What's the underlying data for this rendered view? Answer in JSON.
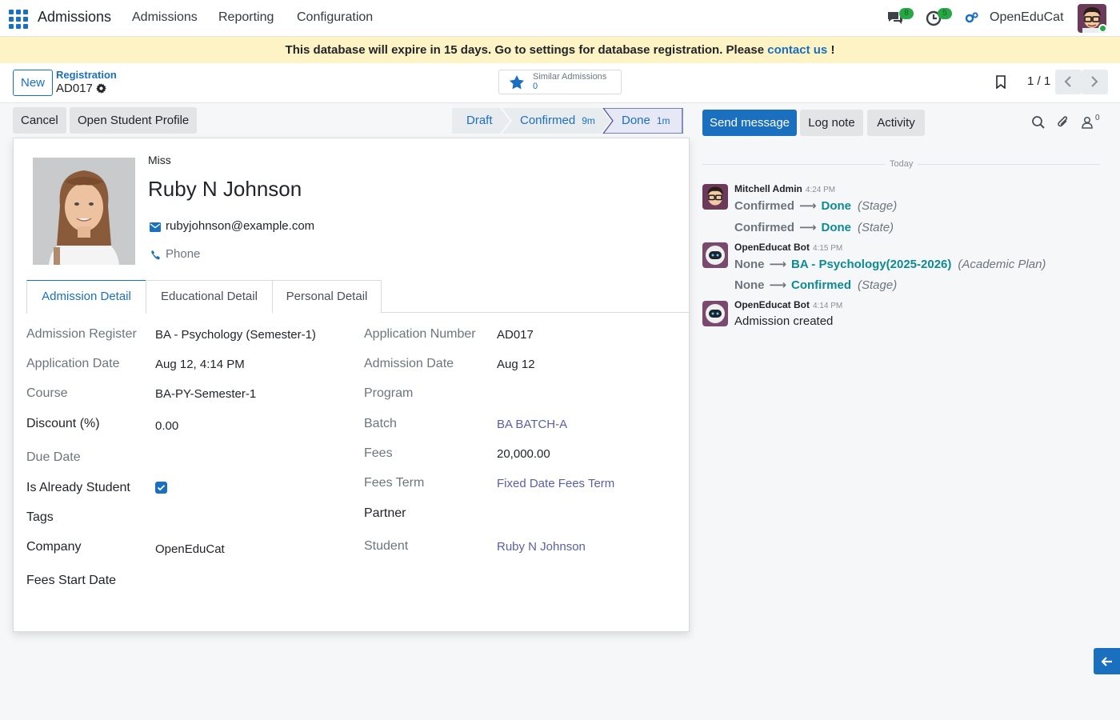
{
  "navbar": {
    "app_name": "Admissions",
    "menu": [
      "Admissions",
      "Reporting",
      "Configuration"
    ],
    "messages_count": "8",
    "activities_count": "5",
    "company": "OpenEduCat"
  },
  "banner": {
    "text": "This database will expire in 15 days. Go to settings for database registration. Please",
    "link": "contact us",
    "suffix": "!"
  },
  "control": {
    "new_label": "New",
    "breadcrumb_parent": "Registration",
    "breadcrumb_current": "AD017",
    "similar_label": "Similar Admissions",
    "similar_count": "0",
    "pager": "1 / 1"
  },
  "actions": {
    "cancel": "Cancel",
    "open_profile": "Open Student Profile"
  },
  "stages": [
    {
      "label": "Draft",
      "duration": ""
    },
    {
      "label": "Confirmed",
      "duration": "9m"
    },
    {
      "label": "Done",
      "duration": "1m"
    }
  ],
  "form": {
    "title": "Miss",
    "name": "Ruby N Johnson",
    "email": "rubyjohnson@example.com",
    "phone_placeholder": "Phone",
    "tabs": [
      "Admission Detail",
      "Educational Detail",
      "Personal Detail"
    ],
    "left": [
      {
        "label": "Admission Register",
        "value": "BA - Psychology (Semester-1)"
      },
      {
        "label": "Application Date",
        "value": "Aug 12, 4:14 PM"
      },
      {
        "label": "Course",
        "value": "BA-PY-Semester-1"
      },
      {
        "label": "Discount (%)",
        "value": "0.00"
      },
      {
        "label": "Due Date",
        "value": ""
      },
      {
        "label": "Is Already Student",
        "value": true
      },
      {
        "label": "Tags",
        "value": ""
      },
      {
        "label": "Company",
        "value": "OpenEduCat"
      },
      {
        "label": "Fees Start Date",
        "value": ""
      }
    ],
    "right": [
      {
        "label": "Application Number",
        "value": "AD017"
      },
      {
        "label": "Admission Date",
        "value": "Aug 12"
      },
      {
        "label": "Program",
        "value": ""
      },
      {
        "label": "Batch",
        "value": "BA BATCH-A"
      },
      {
        "label": "Fees",
        "value": "20,000.00"
      },
      {
        "label": "Fees Term",
        "value": "Fixed Date Fees Term"
      },
      {
        "label": "Partner",
        "value": ""
      },
      {
        "label": "Student",
        "value": "Ruby N Johnson"
      }
    ]
  },
  "chatter": {
    "send_message": "Send message",
    "log_note": "Log note",
    "activity": "Activity",
    "followers_count": "0",
    "date_separator": "Today",
    "messages": [
      {
        "author": "Mitchell Admin",
        "time": "4:24 PM",
        "tracking": [
          {
            "old": "Confirmed",
            "new": "Done",
            "field": "(Stage)"
          },
          {
            "old": "Confirmed",
            "new": "Done",
            "field": "(State)"
          }
        ]
      },
      {
        "author": "OpenEducat Bot",
        "time": "4:15 PM",
        "tracking": [
          {
            "old": "None",
            "new": "BA - Psychology(2025-2026)",
            "field": "(Academic Plan)"
          },
          {
            "old": "None",
            "new": "Confirmed",
            "field": "(Stage)"
          }
        ]
      },
      {
        "author": "OpenEducat Bot",
        "time": "4:14 PM",
        "body": "Admission created"
      }
    ]
  }
}
